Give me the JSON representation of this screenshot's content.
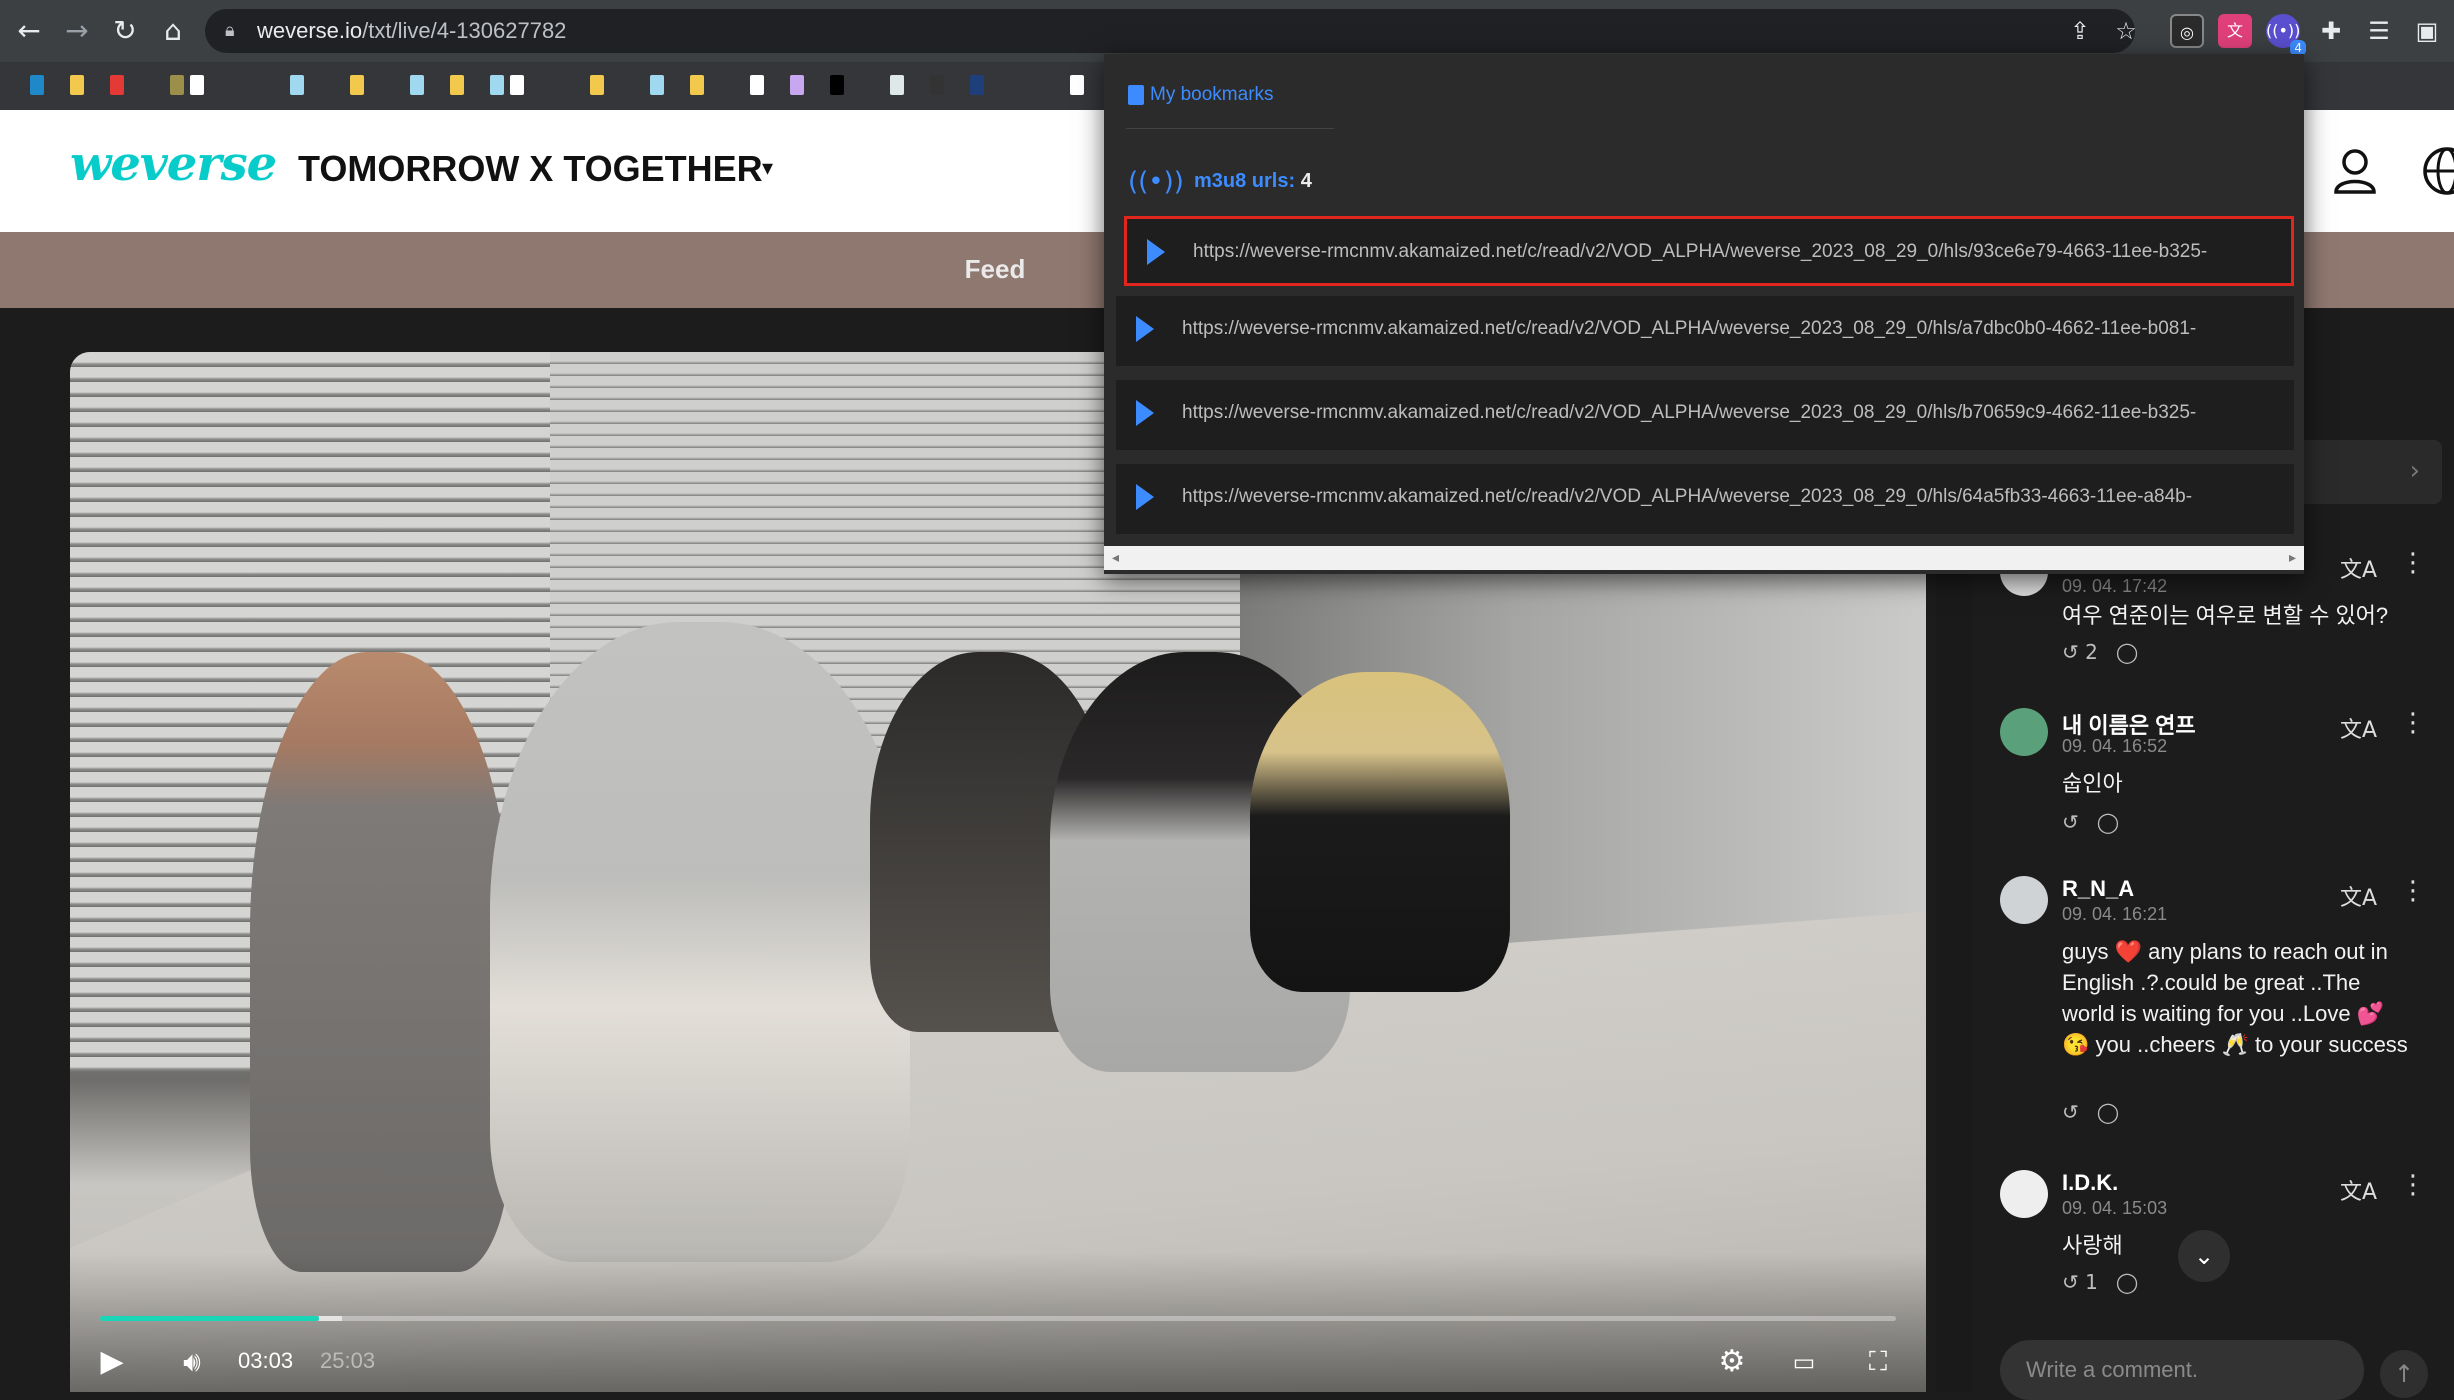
{
  "browser": {
    "url_host": "weverse.io",
    "url_path": "/txt/live/4-130627782",
    "nav": {
      "back": "←",
      "forward": "→",
      "reload": "↻",
      "home": "⌂"
    },
    "extension_badge": "4",
    "bookmark_colors": [
      "#1e88c8",
      "#f2c94c",
      "#e53935",
      "#9c8f4a",
      "#ffffff",
      "#9fd8ef",
      "#f2c94c",
      "#9fd8ef",
      "#f2c94c",
      "#9fd8ef",
      "#ffffff",
      "#f2c94c",
      "#9fd8ef",
      "#f2c94c",
      "#ffffff",
      "#c7a8f0",
      "#000000",
      "#dfe8e8",
      "#333333",
      "#1f3f7a",
      "#ffffff"
    ]
  },
  "site": {
    "logo": "weverse",
    "artist": "TOMORROW X TOGETHER",
    "tab_feed": "Feed"
  },
  "video": {
    "time_current": "03:03",
    "time_total": "25:03",
    "progress_fraction": 0.122,
    "buffered_fraction": 0.135
  },
  "comments": {
    "items": [
      {
        "name": "",
        "date": "09. 04. 17:42",
        "body": "여우 연준이는 여우로 변할 수 있어?",
        "replies": "2"
      },
      {
        "name": "내 이름은 연프",
        "date": "09. 04. 16:52",
        "body": "숩인아",
        "replies": ""
      },
      {
        "name": "R_N_A",
        "date": "09. 04. 16:21",
        "body": "guys ❤️ any plans to reach out in English .?.could be great ..The world is waiting for you ..Love 💕 😘 you ..cheers 🥂 to your success",
        "replies": ""
      },
      {
        "name": "I.D.K.",
        "date": "09. 04. 15:03",
        "body": "사랑해",
        "replies": "1"
      }
    ],
    "input_placeholder": "Write a comment."
  },
  "popup": {
    "bookmarks_link": "My bookmarks",
    "m3u8_label": "m3u8 urls:",
    "m3u8_count": "4",
    "urls": [
      "https://weverse-rmcnmv.akamaized.net/c/read/v2/VOD_ALPHA/weverse_2023_08_29_0/hls/93ce6e79-4663-11ee-b325-",
      "https://weverse-rmcnmv.akamaized.net/c/read/v2/VOD_ALPHA/weverse_2023_08_29_0/hls/a7dbc0b0-4662-11ee-b081-",
      "https://weverse-rmcnmv.akamaized.net/c/read/v2/VOD_ALPHA/weverse_2023_08_29_0/hls/b70659c9-4662-11ee-b325-",
      "https://weverse-rmcnmv.akamaized.net/c/read/v2/VOD_ALPHA/weverse_2023_08_29_0/hls/64a5fb33-4663-11ee-a84b-"
    ]
  },
  "icons": {
    "back": "arrow-left-icon",
    "forward": "arrow-right-icon",
    "reload": "reload-icon",
    "home": "home-icon",
    "share": "share-icon",
    "star": "star-icon",
    "puzzle": "puzzle-icon",
    "user": "user-icon",
    "globe": "globe-icon",
    "play": "play-icon",
    "volume": "volume-icon",
    "settings": "gear-icon",
    "theater": "theater-icon",
    "fullscreen": "fullscreen-icon"
  }
}
